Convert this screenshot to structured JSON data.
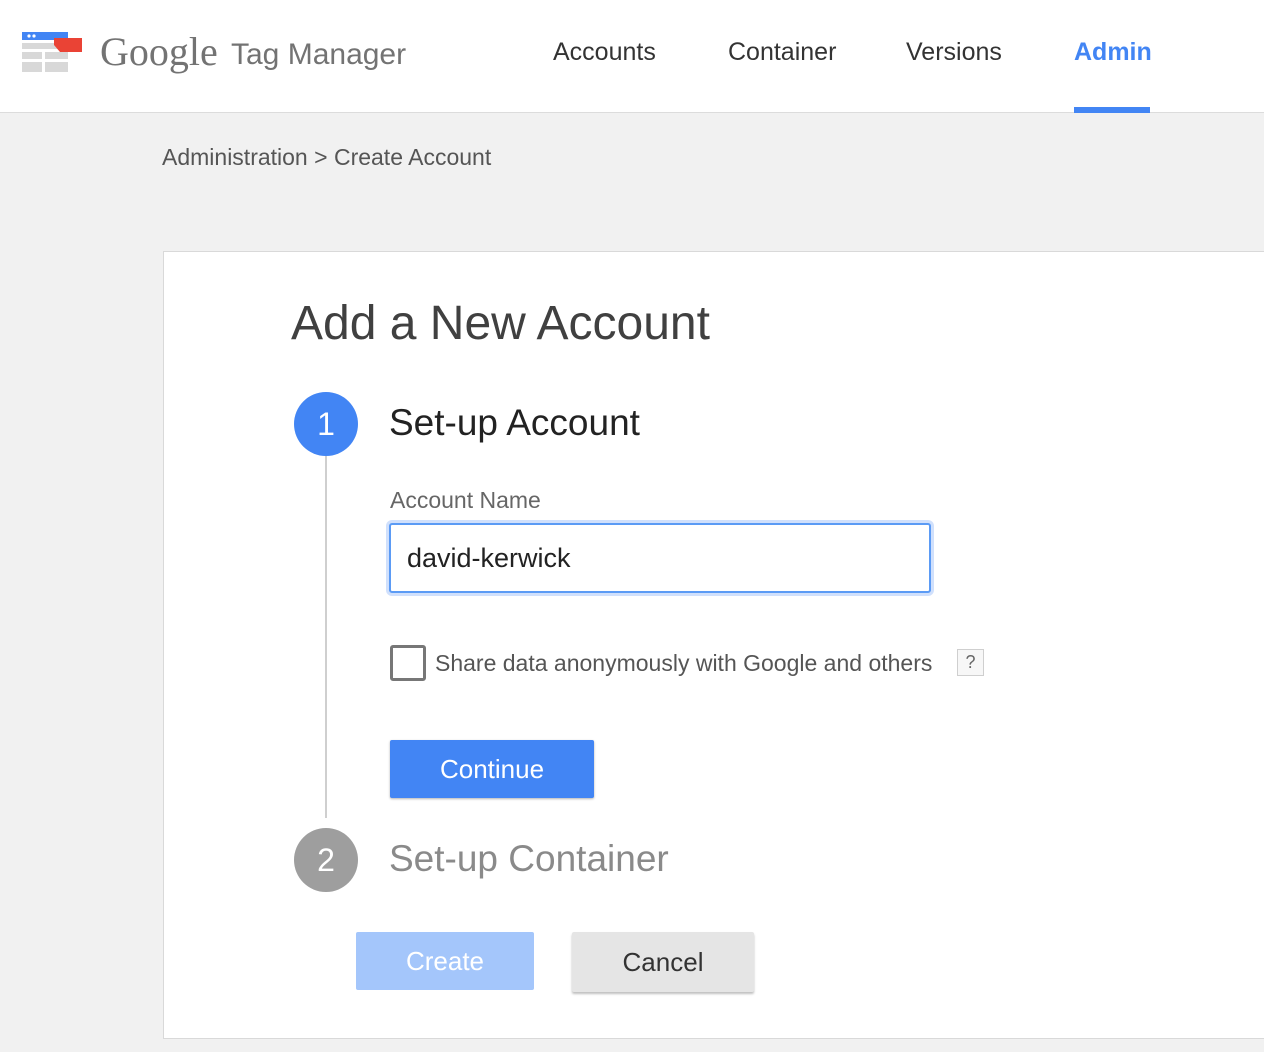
{
  "header": {
    "brand_google": "Google",
    "brand_product": "Tag Manager",
    "nav": [
      {
        "label": "Accounts",
        "active": false
      },
      {
        "label": "Container",
        "active": false
      },
      {
        "label": "Versions",
        "active": false
      },
      {
        "label": "Admin",
        "active": true
      }
    ]
  },
  "breadcrumb": {
    "parent": "Administration",
    "separator": ">",
    "current": "Create Account"
  },
  "form": {
    "title": "Add a New Account",
    "step1": {
      "number": "1",
      "title": "Set-up Account",
      "account_name_label": "Account Name",
      "account_name_value": "david-kerwick",
      "share_checkbox_label": "Share data anonymously with Google and others",
      "share_checkbox_checked": false,
      "help_icon": "?",
      "continue_label": "Continue"
    },
    "step2": {
      "number": "2",
      "title": "Set-up Container"
    },
    "create_label": "Create",
    "cancel_label": "Cancel"
  },
  "colors": {
    "accent": "#4285f4",
    "disabled_button": "#a4c6fb",
    "logo_red": "#ea4335"
  }
}
